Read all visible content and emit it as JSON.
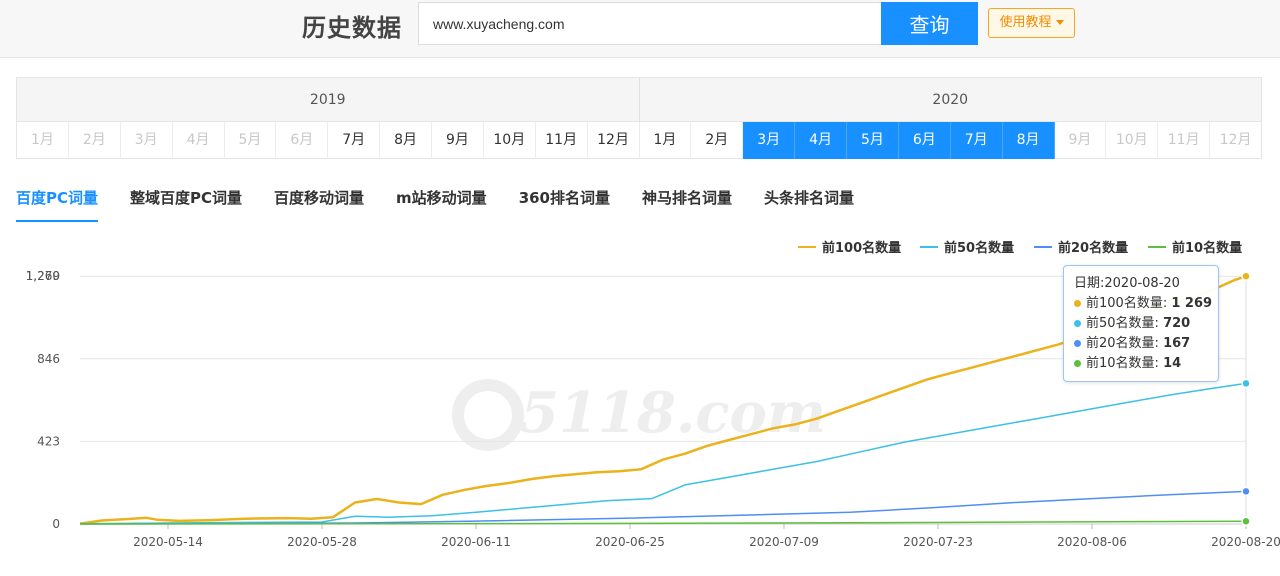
{
  "header": {
    "title": "历史数据",
    "search_value": "www.xuyacheng.com",
    "search_button": "查询",
    "tutorial_button": "使用教程"
  },
  "calendar": {
    "years": [
      "2019",
      "2020"
    ],
    "months": [
      {
        "label": "1月",
        "state": "disabled"
      },
      {
        "label": "2月",
        "state": "disabled"
      },
      {
        "label": "3月",
        "state": "disabled"
      },
      {
        "label": "4月",
        "state": "disabled"
      },
      {
        "label": "5月",
        "state": "disabled"
      },
      {
        "label": "6月",
        "state": "disabled"
      },
      {
        "label": "7月",
        "state": "normal"
      },
      {
        "label": "8月",
        "state": "normal"
      },
      {
        "label": "9月",
        "state": "normal"
      },
      {
        "label": "10月",
        "state": "normal"
      },
      {
        "label": "11月",
        "state": "normal"
      },
      {
        "label": "12月",
        "state": "normal"
      },
      {
        "label": "1月",
        "state": "normal"
      },
      {
        "label": "2月",
        "state": "normal"
      },
      {
        "label": "3月",
        "state": "active"
      },
      {
        "label": "4月",
        "state": "active"
      },
      {
        "label": "5月",
        "state": "active"
      },
      {
        "label": "6月",
        "state": "active"
      },
      {
        "label": "7月",
        "state": "active"
      },
      {
        "label": "8月",
        "state": "active"
      },
      {
        "label": "9月",
        "state": "disabled"
      },
      {
        "label": "10月",
        "state": "disabled"
      },
      {
        "label": "11月",
        "state": "disabled"
      },
      {
        "label": "12月",
        "state": "disabled"
      }
    ]
  },
  "tabs": [
    {
      "label": "百度PC词量",
      "active": true
    },
    {
      "label": "整域百度PC词量",
      "active": false
    },
    {
      "label": "百度移动词量",
      "active": false
    },
    {
      "label": "m站移动词量",
      "active": false
    },
    {
      "label": "360排名词量",
      "active": false
    },
    {
      "label": "神马排名词量",
      "active": false
    },
    {
      "label": "头条排名词量",
      "active": false
    }
  ],
  "tooltip": {
    "date_label": "日期:2020-08-20",
    "rows": [
      {
        "label": "前100名数量: ",
        "value": "1 269",
        "color": "#ebb21c"
      },
      {
        "label": "前50名数量: ",
        "value": "720",
        "color": "#3cc0e6"
      },
      {
        "label": "前20名数量: ",
        "value": "167",
        "color": "#4e8ef5"
      },
      {
        "label": "前10名数量: ",
        "value": "14",
        "color": "#5cc03b"
      }
    ]
  },
  "watermark": "5118.com",
  "chart_data": {
    "type": "line",
    "x_range": [
      "2020-05-06",
      "2020-08-20"
    ],
    "x_ticks": [
      "2020-05-14",
      "2020-05-28",
      "2020-06-11",
      "2020-06-25",
      "2020-07-09",
      "2020-07-23",
      "2020-08-06",
      "2020-08-20"
    ],
    "y_ticks": [
      "0",
      "423",
      "846",
      "1,269",
      "1,270"
    ],
    "ylim": [
      0,
      1270
    ],
    "grid": true,
    "legend_position": "top-right",
    "series": [
      {
        "name": "前100名数量",
        "color": "#ebb21c",
        "points": [
          [
            "2020-05-06",
            2
          ],
          [
            "2020-05-08",
            18
          ],
          [
            "2020-05-10",
            24
          ],
          [
            "2020-05-12",
            32
          ],
          [
            "2020-05-13",
            22
          ],
          [
            "2020-05-15",
            16
          ],
          [
            "2020-05-18",
            20
          ],
          [
            "2020-05-20",
            25
          ],
          [
            "2020-05-22",
            28
          ],
          [
            "2020-05-25",
            30
          ],
          [
            "2020-05-27",
            27
          ],
          [
            "2020-05-29",
            35
          ],
          [
            "2020-05-31",
            110
          ],
          [
            "2020-06-02",
            128
          ],
          [
            "2020-06-04",
            110
          ],
          [
            "2020-06-06",
            102
          ],
          [
            "2020-06-08",
            150
          ],
          [
            "2020-06-10",
            175
          ],
          [
            "2020-06-12",
            195
          ],
          [
            "2020-06-14",
            210
          ],
          [
            "2020-06-16",
            230
          ],
          [
            "2020-06-18",
            245
          ],
          [
            "2020-06-20",
            255
          ],
          [
            "2020-06-22",
            265
          ],
          [
            "2020-06-24",
            270
          ],
          [
            "2020-06-26",
            280
          ],
          [
            "2020-06-28",
            330
          ],
          [
            "2020-06-30",
            360
          ],
          [
            "2020-07-02",
            400
          ],
          [
            "2020-07-04",
            430
          ],
          [
            "2020-07-06",
            460
          ],
          [
            "2020-07-08",
            490
          ],
          [
            "2020-07-10",
            510
          ],
          [
            "2020-07-12",
            540
          ],
          [
            "2020-07-14",
            580
          ],
          [
            "2020-07-16",
            620
          ],
          [
            "2020-07-18",
            660
          ],
          [
            "2020-07-20",
            700
          ],
          [
            "2020-07-22",
            740
          ],
          [
            "2020-07-24",
            770
          ],
          [
            "2020-07-26",
            800
          ],
          [
            "2020-07-28",
            830
          ],
          [
            "2020-07-30",
            860
          ],
          [
            "2020-08-01",
            890
          ],
          [
            "2020-08-03",
            920
          ],
          [
            "2020-08-05",
            960
          ],
          [
            "2020-08-07",
            1000
          ],
          [
            "2020-08-09",
            1040
          ],
          [
            "2020-08-11",
            1080
          ],
          [
            "2020-08-13",
            1120
          ],
          [
            "2020-08-15",
            1160
          ],
          [
            "2020-08-17",
            1200
          ],
          [
            "2020-08-19",
            1250
          ],
          [
            "2020-08-20",
            1269
          ]
        ]
      },
      {
        "name": "前50名数量",
        "color": "#3cc0e6",
        "points": [
          [
            "2020-05-06",
            1
          ],
          [
            "2020-05-14",
            5
          ],
          [
            "2020-05-22",
            8
          ],
          [
            "2020-05-28",
            10
          ],
          [
            "2020-05-31",
            40
          ],
          [
            "2020-06-03",
            35
          ],
          [
            "2020-06-07",
            42
          ],
          [
            "2020-06-11",
            60
          ],
          [
            "2020-06-15",
            80
          ],
          [
            "2020-06-19",
            100
          ],
          [
            "2020-06-23",
            120
          ],
          [
            "2020-06-27",
            130
          ],
          [
            "2020-06-30",
            200
          ],
          [
            "2020-07-04",
            240
          ],
          [
            "2020-07-08",
            280
          ],
          [
            "2020-07-12",
            320
          ],
          [
            "2020-07-16",
            370
          ],
          [
            "2020-07-20",
            420
          ],
          [
            "2020-07-24",
            460
          ],
          [
            "2020-07-28",
            500
          ],
          [
            "2020-08-01",
            540
          ],
          [
            "2020-08-05",
            580
          ],
          [
            "2020-08-09",
            620
          ],
          [
            "2020-08-13",
            660
          ],
          [
            "2020-08-17",
            695
          ],
          [
            "2020-08-20",
            720
          ]
        ]
      },
      {
        "name": "前20名数量",
        "color": "#4e8ef5",
        "points": [
          [
            "2020-05-06",
            0
          ],
          [
            "2020-05-20",
            2
          ],
          [
            "2020-05-31",
            5
          ],
          [
            "2020-06-11",
            15
          ],
          [
            "2020-06-25",
            30
          ],
          [
            "2020-07-05",
            45
          ],
          [
            "2020-07-15",
            60
          ],
          [
            "2020-07-23",
            85
          ],
          [
            "2020-07-30",
            110
          ],
          [
            "2020-08-06",
            130
          ],
          [
            "2020-08-13",
            150
          ],
          [
            "2020-08-20",
            167
          ]
        ]
      },
      {
        "name": "前10名数量",
        "color": "#5cc03b",
        "points": [
          [
            "2020-05-06",
            0
          ],
          [
            "2020-06-01",
            1
          ],
          [
            "2020-06-25",
            3
          ],
          [
            "2020-07-15",
            6
          ],
          [
            "2020-08-01",
            10
          ],
          [
            "2020-08-20",
            14
          ]
        ]
      }
    ]
  }
}
